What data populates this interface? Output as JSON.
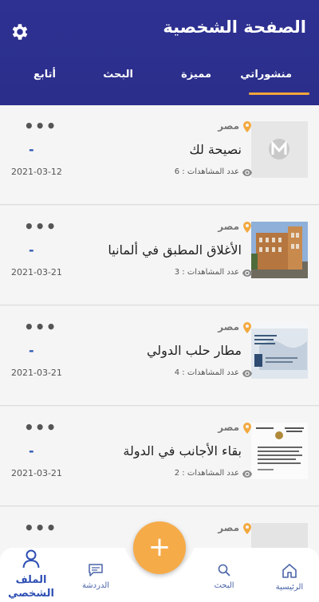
{
  "header": {
    "title": "الصفحة الشخصية",
    "settings_icon": "gear-icon"
  },
  "tabs": [
    {
      "label": "منشوراتي",
      "active": true
    },
    {
      "label": "مميزة",
      "active": false
    },
    {
      "label": "البحث",
      "active": false
    },
    {
      "label": "أتابع",
      "active": false
    }
  ],
  "colors": {
    "header_bg": "#2e3192",
    "accent": "#f6a53c",
    "fab": "#f6ab49",
    "link_blue": "#2b57b5"
  },
  "posts": [
    {
      "location": "مصر",
      "title": "نصيحة لك",
      "dash": "-",
      "views": "عدد المشاهدات : 6",
      "date": "2021-03-12",
      "menu": "•••"
    },
    {
      "location": "مصر",
      "title": "الأغلاق المطبق في ألمانيا",
      "dash": "-",
      "views": "عدد المشاهدات : 3",
      "date": "2021-03-21",
      "menu": "•••"
    },
    {
      "location": "مصر",
      "title": "مطار حلب الدولي",
      "dash": "-",
      "views": "عدد المشاهدات : 4",
      "date": "2021-03-21",
      "menu": "•••"
    },
    {
      "location": "مصر",
      "title": "بقاء الأجانب في الدولة",
      "dash": "-",
      "views": "عدد المشاهدات : 2",
      "date": "2021-03-21",
      "menu": "•••"
    },
    {
      "location": "مصر",
      "title": "",
      "dash": "",
      "views": "",
      "date": "",
      "menu": "•••"
    }
  ],
  "fab": {
    "label": "+"
  },
  "bottom_nav": [
    {
      "label": "الرئيسية",
      "icon": "home-icon"
    },
    {
      "label": "البحث",
      "icon": "search-icon"
    },
    {
      "label": "الدردشة",
      "icon": "chat-icon"
    },
    {
      "label": "الملف الشخصي",
      "icon": "user-icon",
      "active": true
    }
  ]
}
